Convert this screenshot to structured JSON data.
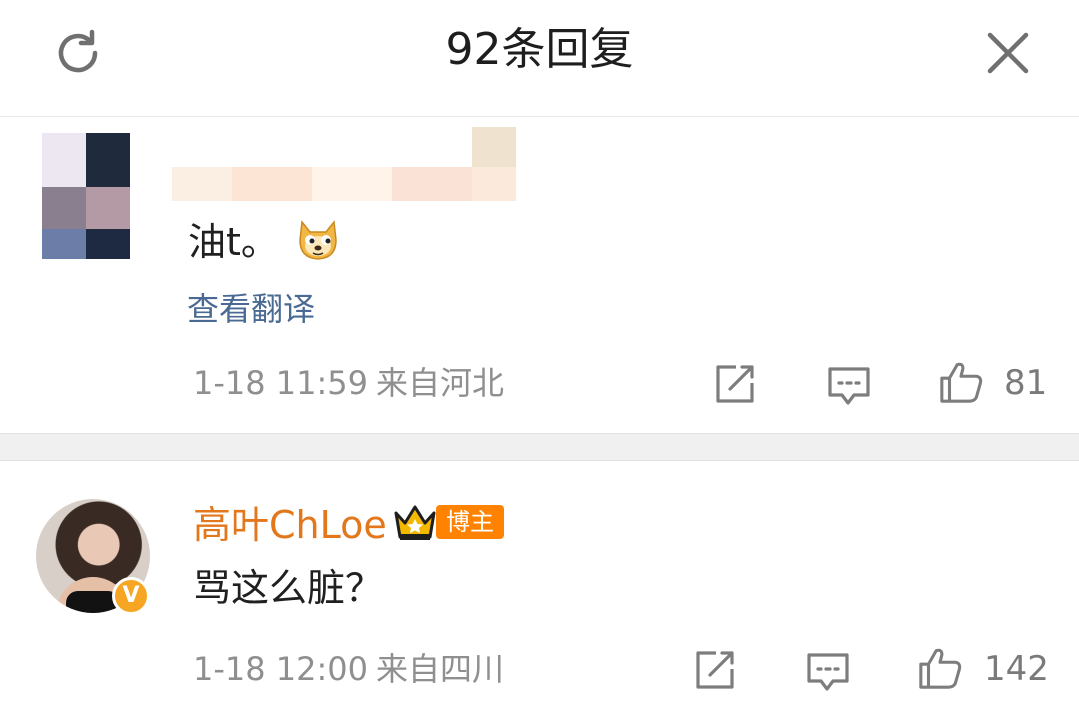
{
  "header": {
    "title": "92条回复",
    "refresh_icon": "refresh-icon",
    "close_icon": "close-icon"
  },
  "comments": [
    {
      "text": "油t。",
      "emoji": "doge-emoji",
      "translate_label": "查看翻译",
      "time": "1-18 11:59",
      "location": "来自河北",
      "likes": "81"
    },
    {
      "username": "高叶ChLoe",
      "badge": "博主",
      "verified_mark": "V",
      "text": "骂这么脏？",
      "time": "1-18 12:00",
      "location": "来自四川",
      "likes": "142"
    }
  ],
  "colors": {
    "username": "#e3771c",
    "link": "#4a6a93",
    "meta": "#8f8f8f",
    "badge": "#ff8200",
    "separator": "#f0f0f0"
  }
}
